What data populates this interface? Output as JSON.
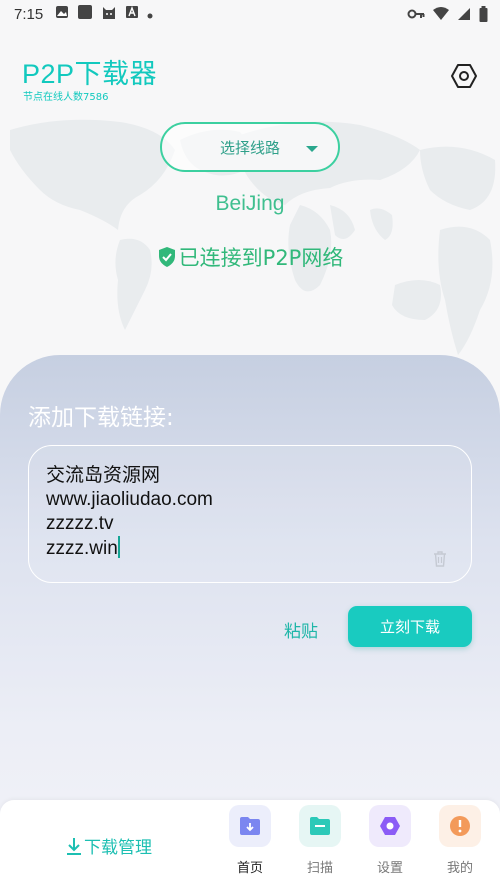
{
  "status_bar": {
    "time": "7:15"
  },
  "header": {
    "title": "P2P下载器",
    "node_count": "节点在线人数7586"
  },
  "route": {
    "select_label": "选择线路",
    "city": "BeiJing",
    "status": "已连接到P2P网络"
  },
  "panel": {
    "title": "添加下载链接:",
    "links": [
      "交流岛资源网",
      "www.jiaoliudao.com",
      "zzzzz.tv",
      "zzzz.win"
    ],
    "paste": "粘贴",
    "download_now": "立刻下载"
  },
  "bottom_nav": {
    "download_manage": "下载管理",
    "items": [
      {
        "label": "首页",
        "icon": "home-download-icon",
        "color": "#7b86f0"
      },
      {
        "label": "扫描",
        "icon": "folder-icon",
        "color": "#2cc9b8"
      },
      {
        "label": "设置",
        "icon": "settings-icon",
        "color": "#8b5cf6"
      },
      {
        "label": "我的",
        "icon": "exclamation-icon",
        "color": "#f39a5a"
      }
    ]
  },
  "colors": {
    "accent": "#19cbc0",
    "connected": "#31b87a"
  }
}
